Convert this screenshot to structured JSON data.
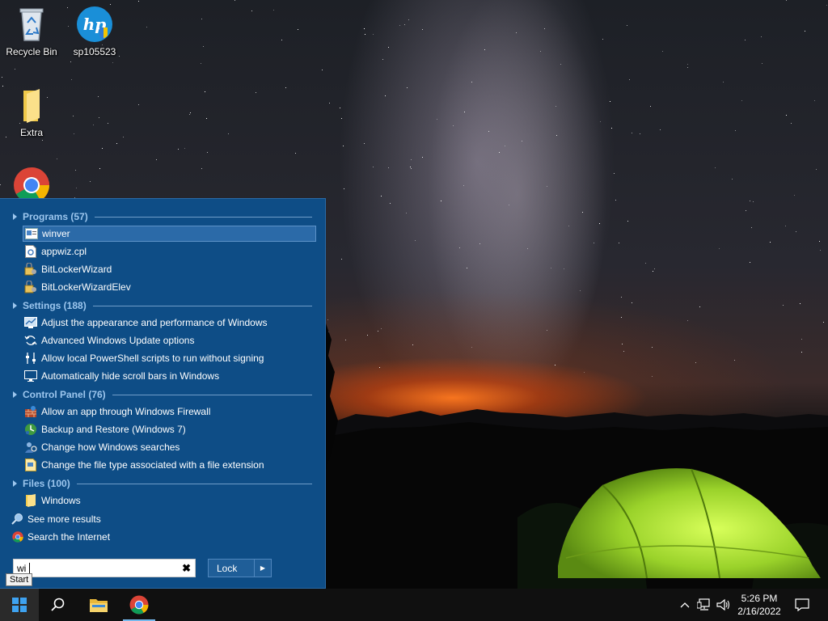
{
  "desktop_icons": [
    {
      "label": "Recycle Bin",
      "icon": "recycle-bin-icon"
    },
    {
      "label": "sp105523",
      "icon": "hp-installer-icon"
    },
    {
      "label": "Extra",
      "icon": "folder-icon"
    },
    {
      "label": "",
      "icon": "chrome-icon"
    }
  ],
  "start_menu": {
    "categories": {
      "programs": "Programs (57)",
      "settings": "Settings (188)",
      "control_panel": "Control Panel (76)",
      "files": "Files (100)"
    },
    "programs": [
      "winver",
      "appwiz.cpl",
      "BitLockerWizard",
      "BitLockerWizardElev"
    ],
    "settings": [
      "Adjust the appearance and performance of Windows",
      "Advanced Windows Update options",
      "Allow local PowerShell scripts to run without signing",
      "Automatically hide scroll bars in Windows"
    ],
    "control_panel": [
      "Allow an app through Windows Firewall",
      "Backup and Restore (Windows 7)",
      "Change how Windows searches",
      "Change the file type associated with a file extension"
    ],
    "files": [
      "Windows"
    ],
    "see_more": "See more results",
    "search_internet": "Search the Internet",
    "search_value": "wi",
    "lock_label": "Lock"
  },
  "tooltip": "Start",
  "clock": {
    "time": "5:26 PM",
    "date": "2/16/2022"
  },
  "colors": {
    "menu_bg": "#0e4d86",
    "category": "#9cc6ee",
    "selected": "#2b6aa8",
    "taskbar": "#101010"
  }
}
